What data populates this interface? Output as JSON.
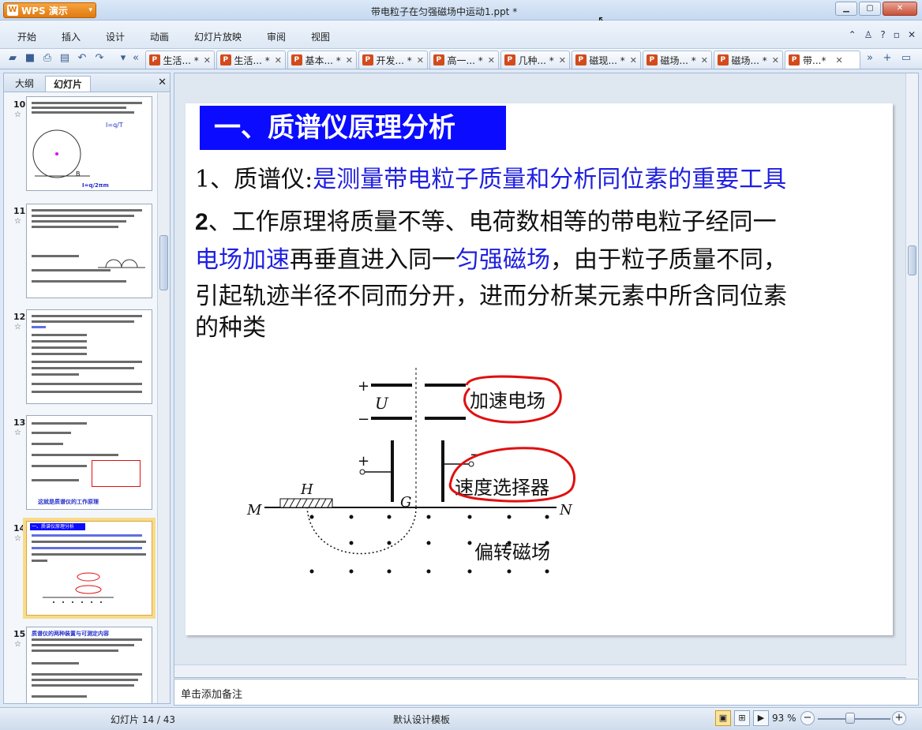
{
  "app": {
    "name": "WPS 演示",
    "window_title": "带电粒子在匀强磁场中运动1.ppt *"
  },
  "menu": [
    "开始",
    "插入",
    "设计",
    "动画",
    "幻灯片放映",
    "审阅",
    "视图"
  ],
  "doc_tabs": [
    {
      "label": "生活... *"
    },
    {
      "label": "生活... *"
    },
    {
      "label": "基本... *"
    },
    {
      "label": "开发... *"
    },
    {
      "label": "高一... *"
    },
    {
      "label": "几种... *"
    },
    {
      "label": "磁现... *"
    },
    {
      "label": "磁场... *"
    },
    {
      "label": "磁场... *"
    },
    {
      "label": "带...*"
    }
  ],
  "left_panel": {
    "tabs": [
      "大纲",
      "幻灯片"
    ],
    "thumbnails": [
      {
        "number": "10",
        "caption": "I=q/2πm"
      },
      {
        "number": "11",
        "caption": ""
      },
      {
        "number": "12",
        "caption": ""
      },
      {
        "number": "13",
        "caption": "这就是质谱仪的工作原理"
      },
      {
        "number": "14",
        "caption": "一、质谱仪原理分析"
      },
      {
        "number": "15",
        "caption": "质谱仪的两种装置与可测定内容"
      }
    ]
  },
  "slide": {
    "title": "一、质谱仪原理分析",
    "line1_prefix": "1、质谱仪:",
    "line1_blue": "是测量带电粒子质量和分析同位素的重要工具",
    "line2_num": "2",
    "line2_text": "、工作原理将质量不等、电荷数相等的带电粒子经同一",
    "line3_blue1": "电场加速",
    "line3_text1": "再垂直进入同一",
    "line3_blue2": "匀强磁场",
    "line3_text2": "，由于粒子质量不同，",
    "line4_text": "引起轨迹半径不同而分开，进而分析某元素中所含同位素",
    "line5_text": "的种类",
    "diagram": {
      "label_plus_top": "+",
      "label_minus_top": "−",
      "label_u": "U",
      "label_accel": "加速电场",
      "label_plus_mid": "+",
      "label_minus_mid": "−",
      "label_selector": "速度选择器",
      "label_g": "G",
      "label_h": "H",
      "label_m": "M",
      "label_n": "N",
      "label_field": "偏转磁场"
    }
  },
  "notes_placeholder": "单击添加备注",
  "status": {
    "page": "幻灯片 14 / 43",
    "template": "默认设计模板",
    "zoom": "93 %"
  }
}
